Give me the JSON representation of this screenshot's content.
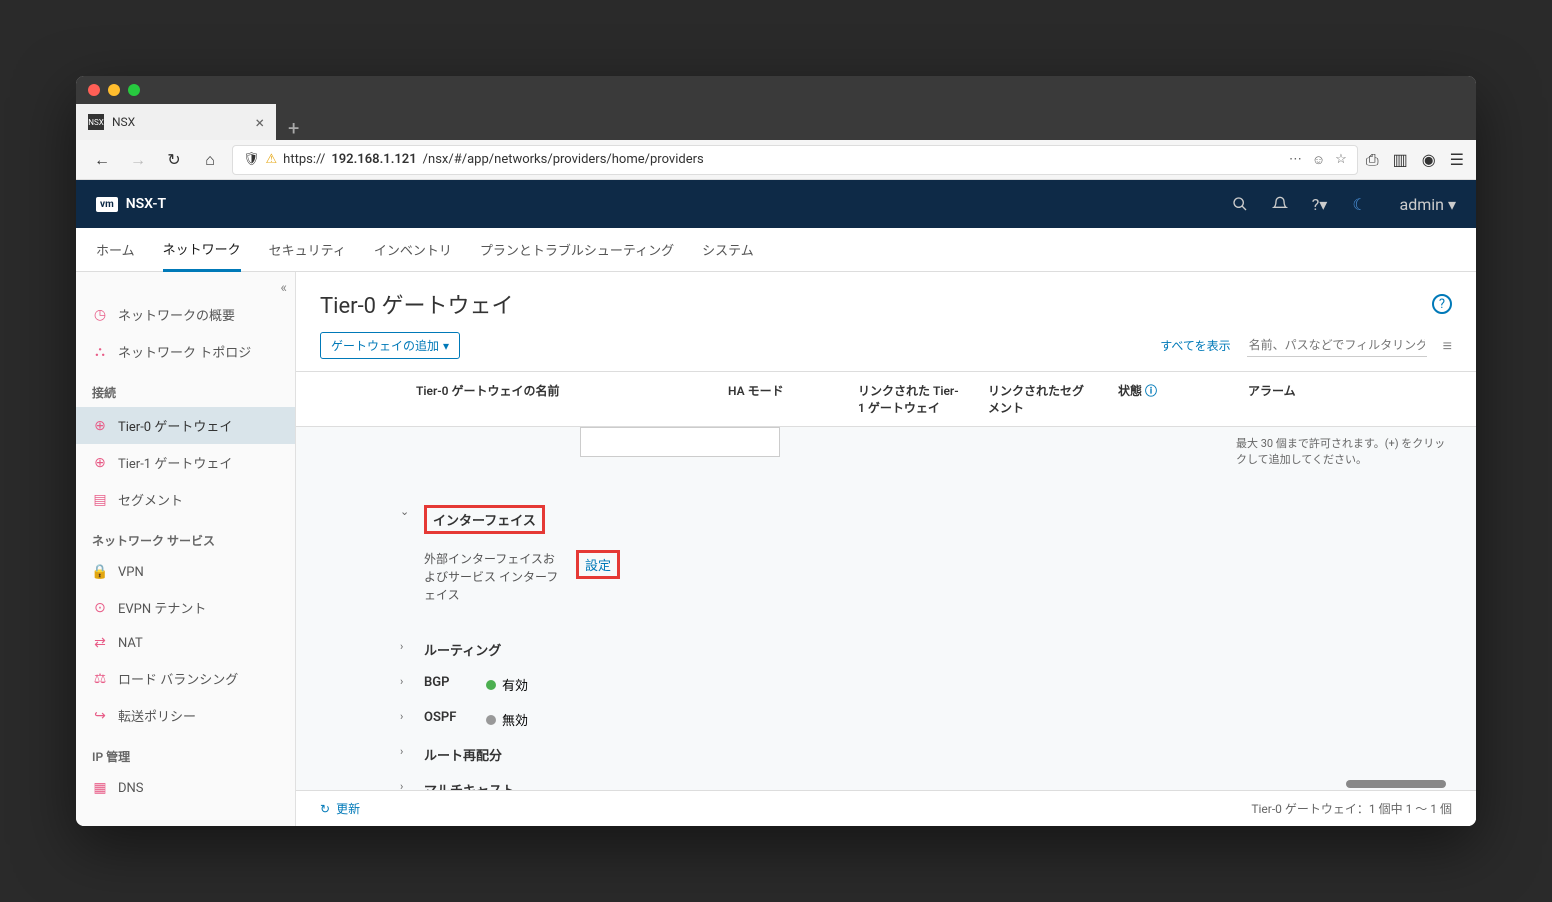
{
  "browser": {
    "tab_title": "NSX",
    "url_prefix": "https://",
    "url_host": "192.168.1.121",
    "url_path": "/nsx/#/app/networks/providers/home/providers"
  },
  "app_header": {
    "product": "NSX-T",
    "user": "admin"
  },
  "nav": {
    "home": "ホーム",
    "network": "ネットワーク",
    "security": "セキュリティ",
    "inventory": "インベントリ",
    "plan": "プランとトラブルシューティング",
    "system": "システム"
  },
  "sidebar": {
    "overview": "ネットワークの概要",
    "topology": "ネットワーク トポロジ",
    "connect_header": "接続",
    "tier0": "Tier-0 ゲートウェイ",
    "tier1": "Tier-1 ゲートウェイ",
    "segment": "セグメント",
    "services_header": "ネットワーク サービス",
    "vpn": "VPN",
    "evpn": "EVPN テナント",
    "nat": "NAT",
    "lb": "ロード バランシング",
    "forward": "転送ポリシー",
    "ip_header": "IP 管理",
    "dns": "DNS"
  },
  "page": {
    "title": "Tier-0 ゲートウェイ",
    "add_button": "ゲートウェイの追加",
    "show_all": "すべてを表示",
    "filter_placeholder": "名前、パスなどでフィルタリング"
  },
  "columns": {
    "name": "Tier-0 ゲートウェイの名前",
    "ha": "HA モード",
    "linked_t1": "リンクされた Tier-1 ゲートウェイ",
    "linked_seg": "リンクされたセグメント",
    "status": "状態",
    "alarm": "アラーム"
  },
  "hint": "最大 30 個まで許可されます。(+) をクリックして追加してください。",
  "sections": {
    "interfaces": "インターフェイス",
    "interfaces_desc": "外部インターフェイスおよびサービス インターフェイス",
    "config": "設定",
    "routing": "ルーティング",
    "bgp": "BGP",
    "bgp_status": "有効",
    "ospf": "OSPF",
    "ospf_status": "無効",
    "redist": "ルート再配分",
    "multicast": "マルチキャスト"
  },
  "footer": {
    "refresh": "更新",
    "count": "Tier-0 ゲートウェイ：1 個中 1 ～ 1 個"
  }
}
